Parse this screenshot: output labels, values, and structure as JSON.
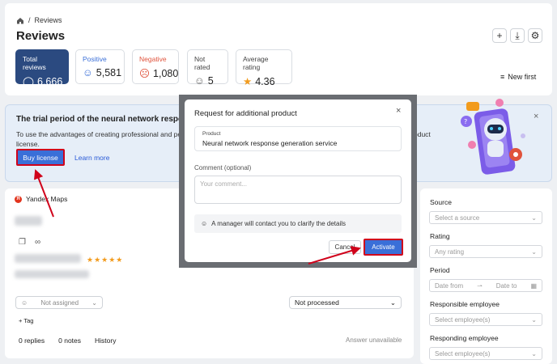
{
  "breadcrumb": {
    "home_icon": "home-icon",
    "current": "Reviews"
  },
  "page": {
    "title": "Reviews"
  },
  "header_actions": [
    {
      "name": "add-button",
      "icon": "plus-icon",
      "glyph": "+"
    },
    {
      "name": "export-button",
      "icon": "download-icon",
      "glyph": "⤓"
    },
    {
      "name": "settings-button",
      "icon": "gear-icon",
      "glyph": "⚙"
    }
  ],
  "stats": [
    {
      "label": "Total reviews",
      "value": "6,666",
      "icon": "chat-icon",
      "glyph": "◯",
      "color": "#ffffff",
      "active": true
    },
    {
      "label": "Positive",
      "value": "5,581",
      "icon": "smile-icon",
      "glyph": "☺",
      "color": "#3a6fd8",
      "active": false
    },
    {
      "label": "Negative",
      "value": "1,080",
      "icon": "frown-icon",
      "glyph": "☹",
      "color": "#e0533c",
      "active": false
    },
    {
      "label": "Not rated",
      "value": "5",
      "icon": "neutral-face-icon",
      "glyph": "☺",
      "color": "#666666",
      "active": false
    },
    {
      "label": "Average rating",
      "value": "4.36",
      "icon": "star-half-icon",
      "glyph": "★",
      "color": "#f29b1d",
      "active": false
    }
  ],
  "sort": {
    "label": "New first",
    "icon": "sort-icon"
  },
  "banner": {
    "title": "The trial period of the neural network response g",
    "text_line1": "To use the advantages of creating professional and pers",
    "text_line2": "license.",
    "text_right": "oduct",
    "buy_label": "Buy license",
    "learn_label": "Learn more"
  },
  "review": {
    "source": "Yandex Maps",
    "source_badge": "Я",
    "stars": "★★★★★",
    "assignee_placeholder": "Not assigned",
    "status": "Not processed",
    "tag_label": "+ Tag",
    "tabs": [
      "0 replies",
      "0 notes",
      "History"
    ],
    "answer_status": "Answer unavailable"
  },
  "filters": {
    "source": {
      "label": "Source",
      "placeholder": "Select a source"
    },
    "rating": {
      "label": "Rating",
      "placeholder": "Any rating"
    },
    "period": {
      "label": "Period",
      "from": "Date from",
      "to": "Date to"
    },
    "responsible": {
      "label": "Responsible employee",
      "placeholder": "Select employee(s)"
    },
    "responding": {
      "label": "Responding employee",
      "placeholder": "Select employee(s)"
    }
  },
  "modal": {
    "title": "Request for additional product",
    "product_label": "Product",
    "product_value": "Neural network response generation service",
    "comment_label": "Comment (optional)",
    "comment_placeholder": "Your comment...",
    "note": "A manager will contact you to clarify the details",
    "cancel_label": "Cancel",
    "activate_label": "Activate"
  },
  "colors": {
    "accent": "#3a6fd8",
    "primary_dark": "#2b4a80",
    "highlight_red": "#d0021b",
    "banner_bg": "#e6eef8"
  }
}
